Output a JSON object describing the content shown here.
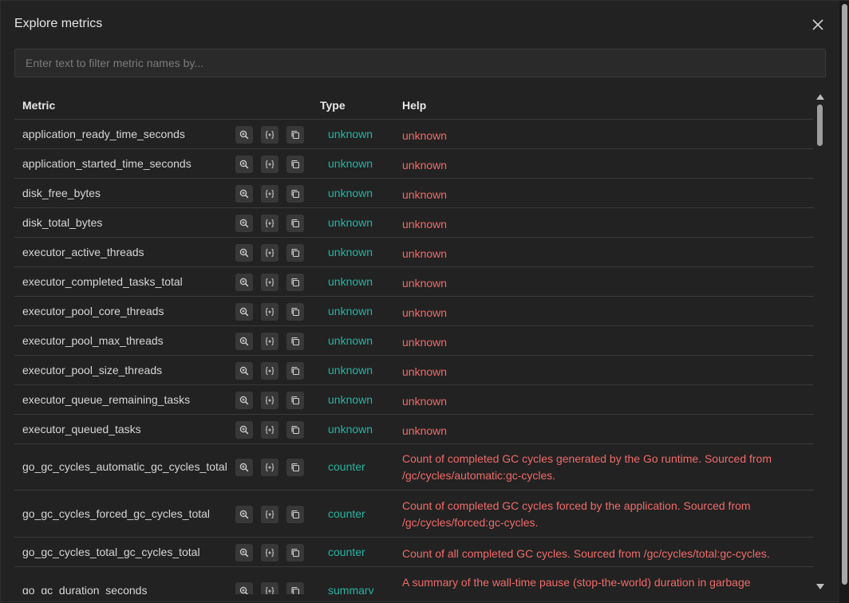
{
  "dialog": {
    "title": "Explore metrics",
    "filter_placeholder": "Enter text to filter metric names by..."
  },
  "table": {
    "headers": {
      "metric": "Metric",
      "type": "Type",
      "help": "Help"
    },
    "rows": [
      {
        "metric": "application_ready_time_seconds",
        "type": "unknown",
        "help": "unknown"
      },
      {
        "metric": "application_started_time_seconds",
        "type": "unknown",
        "help": "unknown"
      },
      {
        "metric": "disk_free_bytes",
        "type": "unknown",
        "help": "unknown"
      },
      {
        "metric": "disk_total_bytes",
        "type": "unknown",
        "help": "unknown"
      },
      {
        "metric": "executor_active_threads",
        "type": "unknown",
        "help": "unknown"
      },
      {
        "metric": "executor_completed_tasks_total",
        "type": "unknown",
        "help": "unknown"
      },
      {
        "metric": "executor_pool_core_threads",
        "type": "unknown",
        "help": "unknown"
      },
      {
        "metric": "executor_pool_max_threads",
        "type": "unknown",
        "help": "unknown"
      },
      {
        "metric": "executor_pool_size_threads",
        "type": "unknown",
        "help": "unknown"
      },
      {
        "metric": "executor_queue_remaining_tasks",
        "type": "unknown",
        "help": "unknown"
      },
      {
        "metric": "executor_queued_tasks",
        "type": "unknown",
        "help": "unknown"
      },
      {
        "metric": "go_gc_cycles_automatic_gc_cycles_total",
        "type": "counter",
        "help": "Count of completed GC cycles generated by the Go runtime. Sourced from /gc/cycles/automatic:gc-cycles."
      },
      {
        "metric": "go_gc_cycles_forced_gc_cycles_total",
        "type": "counter",
        "help": "Count of completed GC cycles forced by the application. Sourced from /gc/cycles/forced:gc-cycles."
      },
      {
        "metric": "go_gc_cycles_total_gc_cycles_total",
        "type": "counter",
        "help": "Count of all completed GC cycles. Sourced from /gc/cycles/total:gc-cycles."
      },
      {
        "metric": "go_gc_duration_seconds",
        "type": "summary",
        "help": "A summary of the wall-time pause (stop-the-world) duration in garbage"
      }
    ]
  },
  "icons": {
    "row_actions": [
      "zoom-in-icon",
      "insert-braces-icon",
      "copy-icon"
    ],
    "close": "close-icon"
  },
  "colors": {
    "type_text": "#27b3a0",
    "help_text": "#f06a6a"
  }
}
